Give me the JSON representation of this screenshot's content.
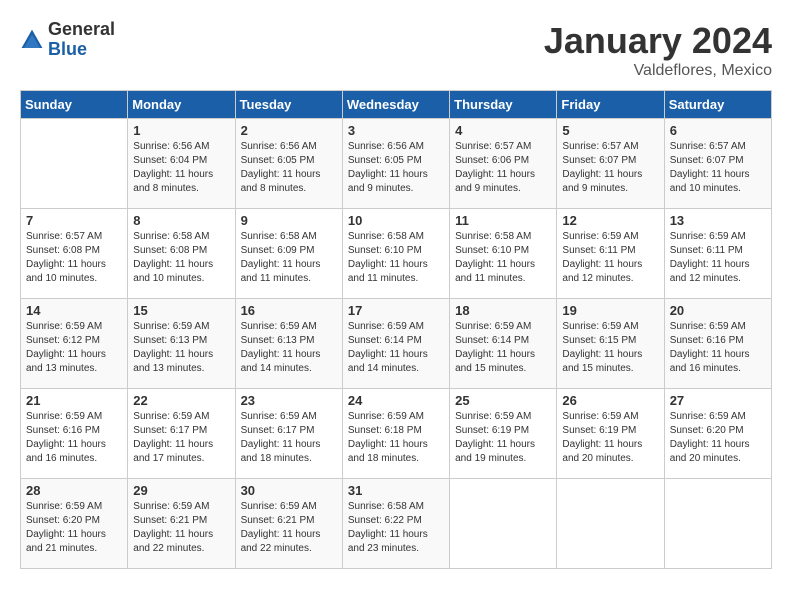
{
  "header": {
    "logo_general": "General",
    "logo_blue": "Blue",
    "month": "January 2024",
    "location": "Valdeflores, Mexico"
  },
  "days_of_week": [
    "Sunday",
    "Monday",
    "Tuesday",
    "Wednesday",
    "Thursday",
    "Friday",
    "Saturday"
  ],
  "weeks": [
    [
      {
        "day": "",
        "sunrise": "",
        "sunset": "",
        "daylight": ""
      },
      {
        "day": "1",
        "sunrise": "Sunrise: 6:56 AM",
        "sunset": "Sunset: 6:04 PM",
        "daylight": "Daylight: 11 hours and 8 minutes."
      },
      {
        "day": "2",
        "sunrise": "Sunrise: 6:56 AM",
        "sunset": "Sunset: 6:05 PM",
        "daylight": "Daylight: 11 hours and 8 minutes."
      },
      {
        "day": "3",
        "sunrise": "Sunrise: 6:56 AM",
        "sunset": "Sunset: 6:05 PM",
        "daylight": "Daylight: 11 hours and 9 minutes."
      },
      {
        "day": "4",
        "sunrise": "Sunrise: 6:57 AM",
        "sunset": "Sunset: 6:06 PM",
        "daylight": "Daylight: 11 hours and 9 minutes."
      },
      {
        "day": "5",
        "sunrise": "Sunrise: 6:57 AM",
        "sunset": "Sunset: 6:07 PM",
        "daylight": "Daylight: 11 hours and 9 minutes."
      },
      {
        "day": "6",
        "sunrise": "Sunrise: 6:57 AM",
        "sunset": "Sunset: 6:07 PM",
        "daylight": "Daylight: 11 hours and 10 minutes."
      }
    ],
    [
      {
        "day": "7",
        "sunrise": "Sunrise: 6:57 AM",
        "sunset": "Sunset: 6:08 PM",
        "daylight": "Daylight: 11 hours and 10 minutes."
      },
      {
        "day": "8",
        "sunrise": "Sunrise: 6:58 AM",
        "sunset": "Sunset: 6:08 PM",
        "daylight": "Daylight: 11 hours and 10 minutes."
      },
      {
        "day": "9",
        "sunrise": "Sunrise: 6:58 AM",
        "sunset": "Sunset: 6:09 PM",
        "daylight": "Daylight: 11 hours and 11 minutes."
      },
      {
        "day": "10",
        "sunrise": "Sunrise: 6:58 AM",
        "sunset": "Sunset: 6:10 PM",
        "daylight": "Daylight: 11 hours and 11 minutes."
      },
      {
        "day": "11",
        "sunrise": "Sunrise: 6:58 AM",
        "sunset": "Sunset: 6:10 PM",
        "daylight": "Daylight: 11 hours and 11 minutes."
      },
      {
        "day": "12",
        "sunrise": "Sunrise: 6:59 AM",
        "sunset": "Sunset: 6:11 PM",
        "daylight": "Daylight: 11 hours and 12 minutes."
      },
      {
        "day": "13",
        "sunrise": "Sunrise: 6:59 AM",
        "sunset": "Sunset: 6:11 PM",
        "daylight": "Daylight: 11 hours and 12 minutes."
      }
    ],
    [
      {
        "day": "14",
        "sunrise": "Sunrise: 6:59 AM",
        "sunset": "Sunset: 6:12 PM",
        "daylight": "Daylight: 11 hours and 13 minutes."
      },
      {
        "day": "15",
        "sunrise": "Sunrise: 6:59 AM",
        "sunset": "Sunset: 6:13 PM",
        "daylight": "Daylight: 11 hours and 13 minutes."
      },
      {
        "day": "16",
        "sunrise": "Sunrise: 6:59 AM",
        "sunset": "Sunset: 6:13 PM",
        "daylight": "Daylight: 11 hours and 14 minutes."
      },
      {
        "day": "17",
        "sunrise": "Sunrise: 6:59 AM",
        "sunset": "Sunset: 6:14 PM",
        "daylight": "Daylight: 11 hours and 14 minutes."
      },
      {
        "day": "18",
        "sunrise": "Sunrise: 6:59 AM",
        "sunset": "Sunset: 6:14 PM",
        "daylight": "Daylight: 11 hours and 15 minutes."
      },
      {
        "day": "19",
        "sunrise": "Sunrise: 6:59 AM",
        "sunset": "Sunset: 6:15 PM",
        "daylight": "Daylight: 11 hours and 15 minutes."
      },
      {
        "day": "20",
        "sunrise": "Sunrise: 6:59 AM",
        "sunset": "Sunset: 6:16 PM",
        "daylight": "Daylight: 11 hours and 16 minutes."
      }
    ],
    [
      {
        "day": "21",
        "sunrise": "Sunrise: 6:59 AM",
        "sunset": "Sunset: 6:16 PM",
        "daylight": "Daylight: 11 hours and 16 minutes."
      },
      {
        "day": "22",
        "sunrise": "Sunrise: 6:59 AM",
        "sunset": "Sunset: 6:17 PM",
        "daylight": "Daylight: 11 hours and 17 minutes."
      },
      {
        "day": "23",
        "sunrise": "Sunrise: 6:59 AM",
        "sunset": "Sunset: 6:17 PM",
        "daylight": "Daylight: 11 hours and 18 minutes."
      },
      {
        "day": "24",
        "sunrise": "Sunrise: 6:59 AM",
        "sunset": "Sunset: 6:18 PM",
        "daylight": "Daylight: 11 hours and 18 minutes."
      },
      {
        "day": "25",
        "sunrise": "Sunrise: 6:59 AM",
        "sunset": "Sunset: 6:19 PM",
        "daylight": "Daylight: 11 hours and 19 minutes."
      },
      {
        "day": "26",
        "sunrise": "Sunrise: 6:59 AM",
        "sunset": "Sunset: 6:19 PM",
        "daylight": "Daylight: 11 hours and 20 minutes."
      },
      {
        "day": "27",
        "sunrise": "Sunrise: 6:59 AM",
        "sunset": "Sunset: 6:20 PM",
        "daylight": "Daylight: 11 hours and 20 minutes."
      }
    ],
    [
      {
        "day": "28",
        "sunrise": "Sunrise: 6:59 AM",
        "sunset": "Sunset: 6:20 PM",
        "daylight": "Daylight: 11 hours and 21 minutes."
      },
      {
        "day": "29",
        "sunrise": "Sunrise: 6:59 AM",
        "sunset": "Sunset: 6:21 PM",
        "daylight": "Daylight: 11 hours and 22 minutes."
      },
      {
        "day": "30",
        "sunrise": "Sunrise: 6:59 AM",
        "sunset": "Sunset: 6:21 PM",
        "daylight": "Daylight: 11 hours and 22 minutes."
      },
      {
        "day": "31",
        "sunrise": "Sunrise: 6:58 AM",
        "sunset": "Sunset: 6:22 PM",
        "daylight": "Daylight: 11 hours and 23 minutes."
      },
      {
        "day": "",
        "sunrise": "",
        "sunset": "",
        "daylight": ""
      },
      {
        "day": "",
        "sunrise": "",
        "sunset": "",
        "daylight": ""
      },
      {
        "day": "",
        "sunrise": "",
        "sunset": "",
        "daylight": ""
      }
    ]
  ]
}
